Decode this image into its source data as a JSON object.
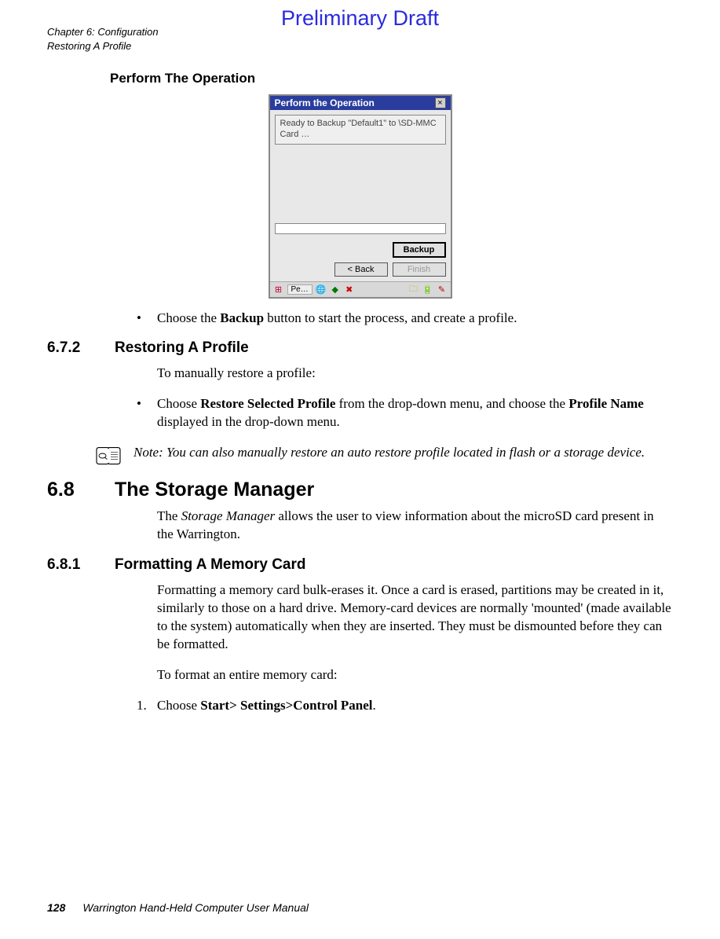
{
  "watermark": "Preliminary Draft",
  "header": {
    "chapter": "Chapter 6:  Configuration",
    "section": "Restoring A Profile"
  },
  "s1": {
    "heading": "Perform The Operation",
    "win_title": "Perform the Operation",
    "msg": "Ready to Backup \"Default1\" to \\SD-MMC Card …",
    "btn_backup": "Backup",
    "btn_back": "<  Back",
    "btn_finish": "Finish",
    "tb_btn": "Pe…",
    "bullet1_a": "Choose the ",
    "bullet1_b": "Backup",
    "bullet1_c": " button to start the process, and create a profile."
  },
  "s672": {
    "num": "6.7.2",
    "title": "Restoring A Profile",
    "intro": "To manually restore a profile:",
    "b1_a": "Choose ",
    "b1_b": "Restore Selected Profile",
    "b1_c": " from the drop-down menu, and choose the ",
    "b1_d": "Profile Name",
    "b1_e": " displayed in the drop-down menu.",
    "note": "Note: You can also manually restore an auto restore profile located in flash or a storage device."
  },
  "s68": {
    "num": "6.8",
    "title": "The Storage Manager",
    "p1_a": "The ",
    "p1_b": "Storage Manager",
    "p1_c": " allows the user to view information about the microSD card present in the Warrington."
  },
  "s681": {
    "num": "6.8.1",
    "title": "Formatting A Memory Card",
    "p1": "Formatting a memory card bulk-erases it. Once a card is erased, partitions may be created in it, similarly to those on a hard drive. Memory-card devices are normally 'mounted' (made available to the system) automatically when they are inserted. They must be dismounted before they can be formatted.",
    "p2": "To format an entire memory card:",
    "step1_a": "Choose ",
    "step1_b": "Start> Settings>Control Panel",
    "step1_c": "."
  },
  "footer": {
    "page": "128",
    "manual": "Warrington Hand-Held Computer User Manual"
  }
}
